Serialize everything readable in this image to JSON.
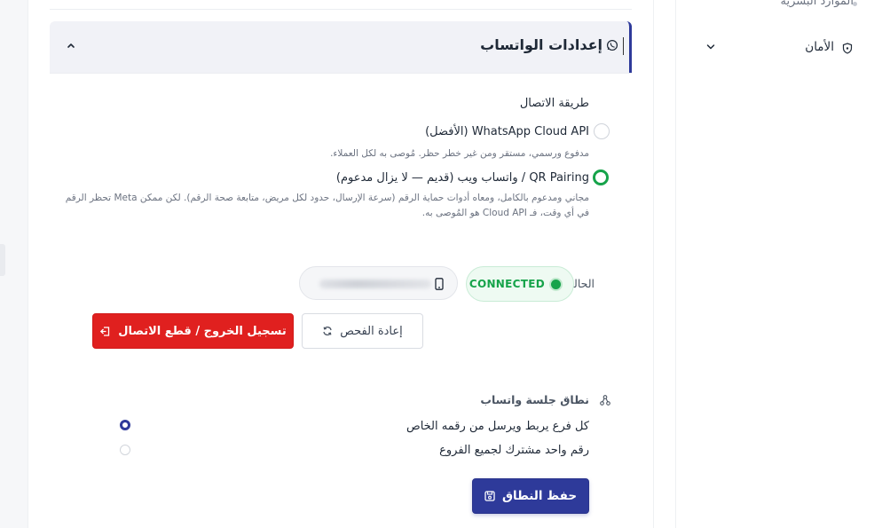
{
  "sidebar": {
    "items": [
      {
        "label": "الموارد البشرية"
      },
      {
        "label": "الأمان"
      }
    ]
  },
  "section": {
    "title": "إعدادات الواتساب"
  },
  "connection": {
    "label": "طريقة الاتصال",
    "options": [
      {
        "title": "WhatsApp Cloud API (الأفضل)",
        "description": "مدفوع ورسمي، مستقر ومن غير خطر حظر. مُوصى به لكل العملاء.",
        "selected": false
      },
      {
        "title": "QR Pairing / واتساب ويب (قديم — لا يزال مدعوم)",
        "description": "مجاني ومدعوم بالكامل، ومعاه أدوات حماية الرقم (سرعة الإرسال، حدود لكل مريض، متابعة صحة الرقم). لكن ممكن Meta تحظر الرقم في أي وقت، فـ Cloud API هو المُوصى به.",
        "selected": true
      }
    ]
  },
  "status": {
    "label": "الحالة:",
    "badge": "CONNECTED",
    "badge_color": "#16a34a"
  },
  "actions": {
    "recheck_label": "إعادة الفحص",
    "logout_label": "تسجيل الخروج / قطع الاتصال"
  },
  "scope": {
    "title": "نطاق جلسة واتساب",
    "options": [
      {
        "label": "كل فرع يربط ويرسل من رقمه الخاص",
        "selected": true
      },
      {
        "label": "رقم واحد مشترك لجميع الفروع",
        "selected": false
      }
    ],
    "save_label": "حفظ النطاق"
  },
  "colors": {
    "primary": "#2e3a9a",
    "danger": "#e0201f",
    "success": "#16a34a"
  }
}
